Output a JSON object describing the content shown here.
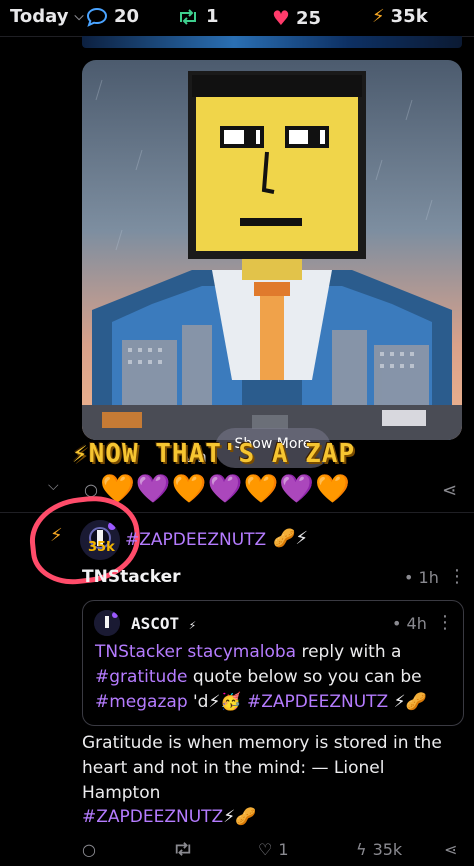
{
  "topbar": {
    "period": "Today",
    "replies": "20",
    "reposts": "1",
    "likes": "25",
    "zaps": "35k"
  },
  "image_post": {
    "show_more": "Show More",
    "overlay_text": "⚡NOW THAT'S A ZAP",
    "overlay_behind": "wh",
    "hearts": "🧡💜🧡💜🧡💜🧡"
  },
  "reply": {
    "zap_amount": "35k",
    "hashtag": "#ZAPDEEZNUTZ",
    "emojis": "🥜⚡",
    "author": "TNStacker",
    "time": "1h",
    "quote": {
      "author": "ASCOT",
      "author_suffix": "⚡",
      "time": "4h",
      "line1_mentions": "TNStacker stacymaloba",
      "line1_text": " reply with a",
      "line2_tag": "#gratitude",
      "line2_text": " quote below so you can be",
      "line3_tag": "#megazap",
      "line3_text": " 'd⚡🥳 ",
      "line3_tag2": "#ZAPDEEZNUTZ",
      "line3_end": " ⚡🥜"
    },
    "body_line1": "Gratitude is when memory is stored in the",
    "body_line2": "heart and not in the mind: — Lionel Hampton",
    "footer_tag": "#ZAPDEEZNUTZ",
    "footer_tag_emoji": "⚡🥜",
    "likes": "1",
    "zaps": "35k"
  },
  "colors": {
    "accent": "#b57cff",
    "zap": "#f6c531",
    "annotation": "#ff4c6a"
  }
}
